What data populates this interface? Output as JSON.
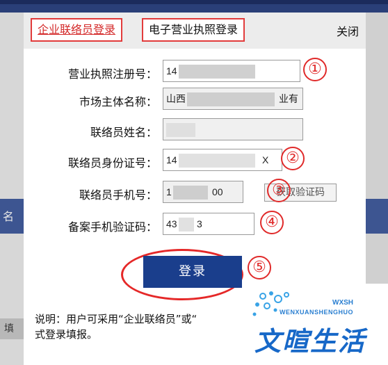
{
  "tabs": [
    {
      "label": "企业联络员登录",
      "active": true
    },
    {
      "label": "电子营业执照登录",
      "active": false
    }
  ],
  "close_label": "关闭",
  "form": {
    "rows": [
      {
        "label": "营业执照注册号：",
        "value": "14",
        "marker": "①"
      },
      {
        "label": "市场主体名称：",
        "value": "山西",
        "value_tail": "业有",
        "marker": ""
      },
      {
        "label": "联络员姓名：",
        "value": "",
        "marker": ""
      },
      {
        "label": "联络员身份证号：",
        "value": "14",
        "value_tail": "X",
        "marker": "②"
      },
      {
        "label": "联络员手机号：",
        "value": "1",
        "value_tail": "00",
        "marker": "③"
      },
      {
        "label": "备案手机验证码：",
        "value": "43",
        "value_tail": "3",
        "marker": "④"
      }
    ],
    "sms_button_label": "获取验证码",
    "login_label": "登录",
    "login_marker": "⑤"
  },
  "note": {
    "line1": "说明：用户可采用“企业联络员”或“",
    "line2": "式登录填报。"
  },
  "background": {
    "left_text": "名",
    "left_text2": "填"
  },
  "watermark": {
    "cn": "文暄生活",
    "en": "WENXUANSHENGHUO",
    "small": "WXSH"
  },
  "colors": {
    "accent_red": "#e23b3b",
    "button_blue": "#1a3e8c",
    "logo_blue": "#1768c8"
  }
}
